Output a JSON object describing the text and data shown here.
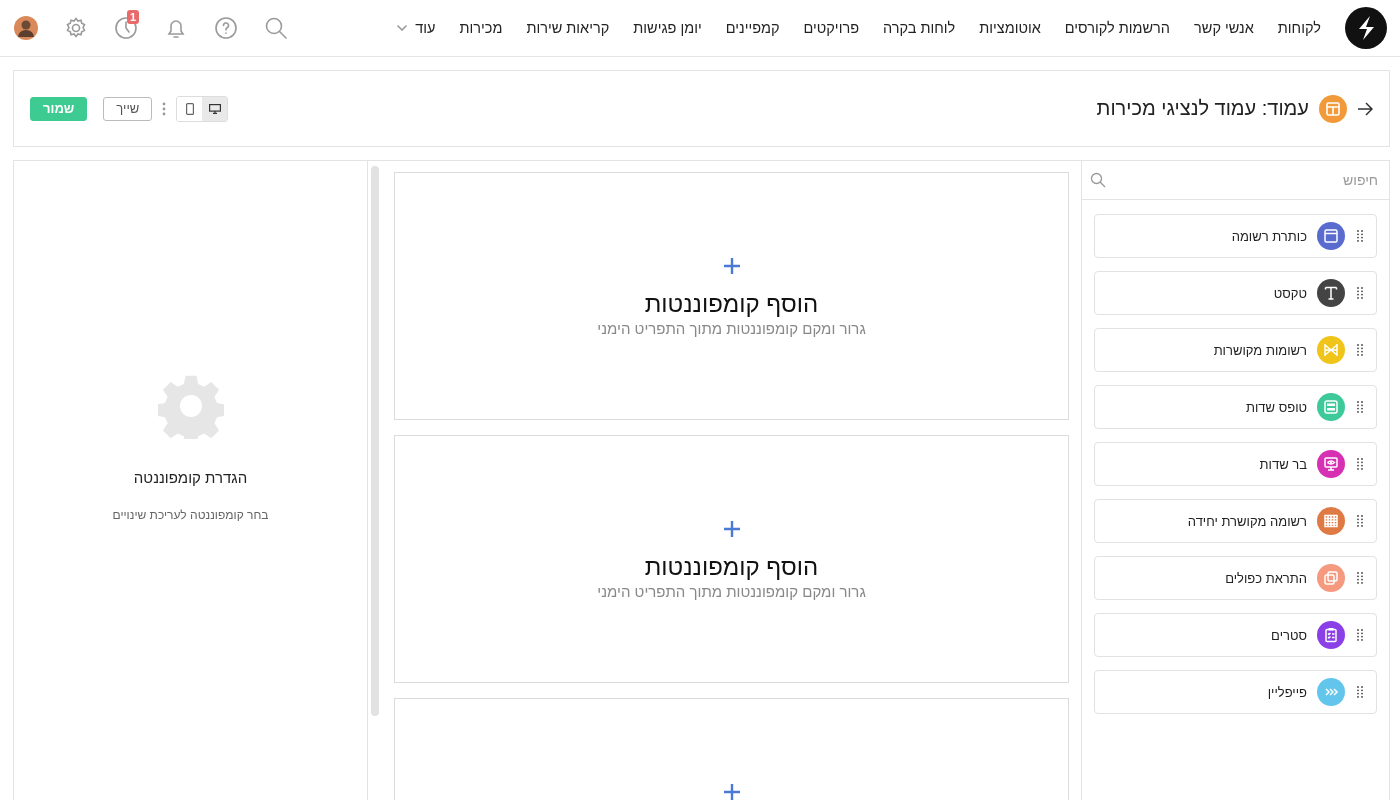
{
  "nav": {
    "items": [
      {
        "label": "לקוחות"
      },
      {
        "label": "אנשי קשר"
      },
      {
        "label": "הרשמות לקורסים"
      },
      {
        "label": "אוטומציות"
      },
      {
        "label": "לוחות בקרה"
      },
      {
        "label": "פרויקטים"
      },
      {
        "label": "קמפיינים"
      },
      {
        "label": "יומן פגישות"
      },
      {
        "label": "קריאות שירות"
      },
      {
        "label": "מכירות"
      }
    ],
    "more": "עוד",
    "history_badge": "1"
  },
  "header": {
    "title": "עמוד: עמוד לנציגי מכירות",
    "devices": [
      {
        "kind": "desktop",
        "selected": true
      },
      {
        "kind": "mobile",
        "selected": false
      }
    ],
    "share_button": "שייך",
    "save_button": "שמור"
  },
  "palette": {
    "search": {
      "placeholder": "חיפוש"
    },
    "items": [
      {
        "label": "כותרת רשומה",
        "kind": "header",
        "color": "#5a6bd0"
      },
      {
        "label": "טקסט",
        "kind": "text",
        "color": "#444444"
      },
      {
        "label": "רשומות מקושרות",
        "kind": "linked",
        "color": "#f0c419"
      },
      {
        "label": "טופס שדות",
        "kind": "form",
        "color": "#3ec99a"
      },
      {
        "label": "בר שדות",
        "kind": "bar",
        "color": "#d631b3"
      },
      {
        "label": "רשומה מקושרת יחידה",
        "kind": "grid",
        "color": "#df7a45"
      },
      {
        "label": "התראת כפולים",
        "kind": "duplicate",
        "color": "#f59a7e"
      },
      {
        "label": "סטרים",
        "kind": "stream",
        "color": "#8b3fe6"
      },
      {
        "label": "פייפליין",
        "kind": "pipeline",
        "color": "#62c6ec"
      }
    ]
  },
  "canvas": {
    "zones": [
      {
        "kind": "drop_zone",
        "title": "הוסף קומפוננטות",
        "subtitle": "גרור ומקם קומפוננטות מתוך התפריט הימני"
      },
      {
        "kind": "drop_zone",
        "title": "הוסף קומפוננטות",
        "subtitle": "גרור ומקם קומפוננטות מתוך התפריט הימני"
      },
      {
        "kind": "drop_zone"
      }
    ]
  },
  "settings": {
    "title": "הגדרת קומפוננטה",
    "hint": "בחר קומפוננטה לעריכת שינויים"
  }
}
